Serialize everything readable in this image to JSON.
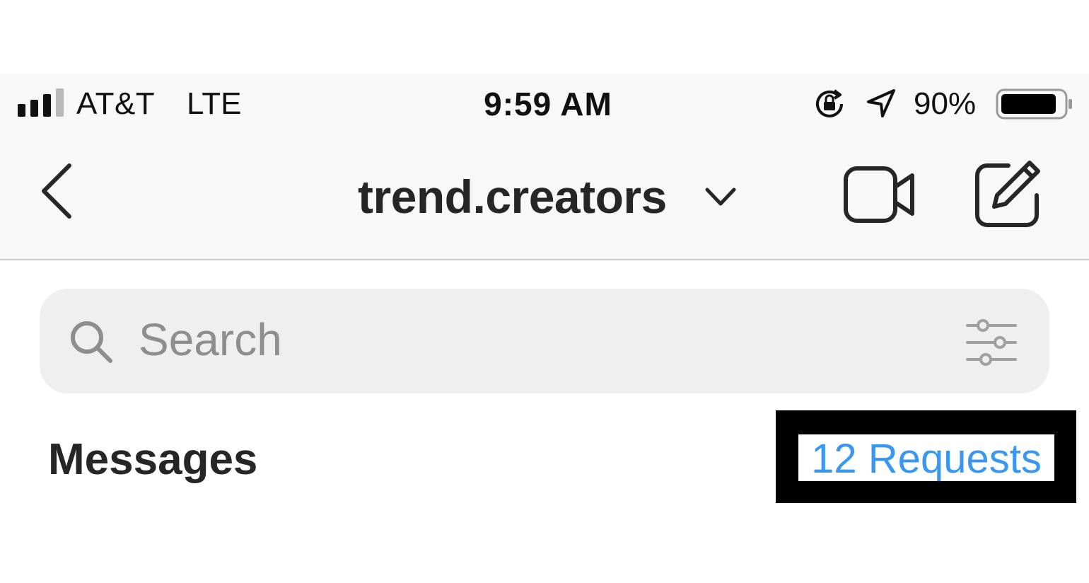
{
  "status_bar": {
    "carrier": "AT&T",
    "network": "LTE",
    "time": "9:59 AM",
    "battery_percent_label": "90%",
    "battery_level": 0.9,
    "signal_bars_active": 3,
    "signal_bars_total": 4,
    "icons": [
      "orientation-lock-icon",
      "location-arrow-icon",
      "battery-icon"
    ]
  },
  "nav": {
    "title": "trend.creators",
    "icons": [
      "back-chevron-icon",
      "chevron-down-icon",
      "video-camera-icon",
      "compose-icon"
    ]
  },
  "search": {
    "placeholder": "Search",
    "value": "",
    "icons": [
      "search-icon",
      "filter-sliders-icon"
    ]
  },
  "messages": {
    "heading": "Messages",
    "requests_label": "12 Requests"
  },
  "colors": {
    "link_blue": "#3897f0",
    "header_bg": "#f8f8f8",
    "search_bg": "#efefef",
    "text_dark": "#262626",
    "placeholder_gray": "#8e8e8e",
    "highlight_box": "#000000"
  }
}
